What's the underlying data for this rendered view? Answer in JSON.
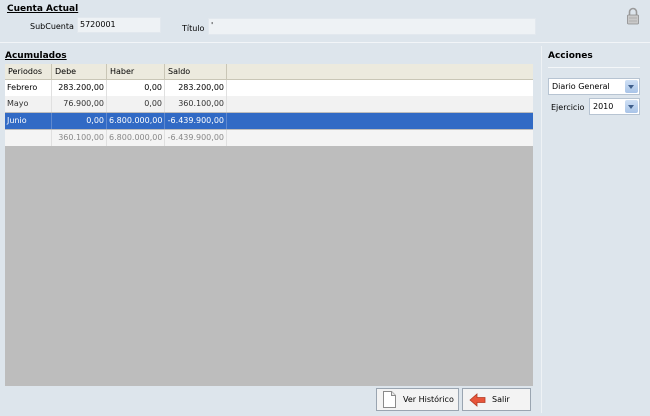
{
  "cuenta": {
    "section_title": "Cuenta Actual",
    "subcuenta_label": "SubCuenta",
    "subcuenta_value": "5720001",
    "titulo_label": "Título",
    "titulo_value": "'"
  },
  "acumulados": {
    "section_title": "Acumulados",
    "columns": [
      "Periodos",
      "Debe",
      "Haber",
      "Saldo"
    ],
    "rows": [
      {
        "periodo": "Febrero",
        "debe": "283.200,00",
        "haber": "0,00",
        "saldo": "283.200,00"
      },
      {
        "periodo": "Mayo",
        "debe": "76.900,00",
        "haber": "0,00",
        "saldo": "360.100,00"
      },
      {
        "periodo": "Junio",
        "debe": "0,00",
        "haber": "6.800.000,00",
        "saldo": "-6.439.900,00"
      }
    ],
    "totals": {
      "periodo": "",
      "debe": "360.100,00",
      "haber": "6.800.000,00",
      "saldo": "-6.439.900,00"
    },
    "selected_row": "Junio"
  },
  "acciones": {
    "section_title": "Acciones",
    "diario_value": "Diario General",
    "ejercicio_label": "Ejercicio",
    "ejercicio_value": "2010"
  },
  "buttons": {
    "ver_historico": "Ver Histórico",
    "salir": "Salir"
  },
  "icons": {
    "lock": "lock-icon",
    "document": "document-icon",
    "exit": "exit-arrow-icon"
  }
}
